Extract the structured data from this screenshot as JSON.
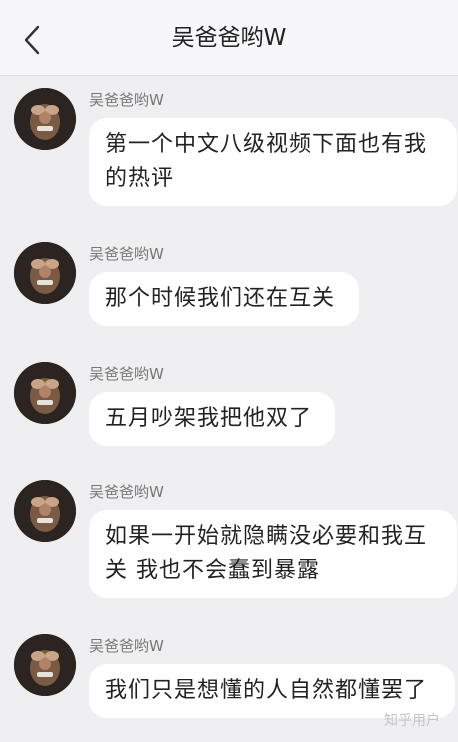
{
  "header": {
    "title": "吴爸爸哟W"
  },
  "messages": [
    {
      "sender": "吴爸爸哟W",
      "text": "第一个中文八级视频下面也有我的热评"
    },
    {
      "sender": "吴爸爸哟W",
      "text": "那个时候我们还在互关"
    },
    {
      "sender": "吴爸爸哟W",
      "text": "五月吵架我把他双了"
    },
    {
      "sender": "吴爸爸哟W",
      "text": "如果一开始就隐瞒没必要和我互关 我也不会蠢到暴露"
    },
    {
      "sender": "吴爸爸哟W",
      "text": "我们只是想懂的人自然都懂罢了"
    }
  ],
  "watermark": "知乎用户",
  "icons": {
    "back": "chevron-left-icon",
    "avatar": "user-avatar"
  }
}
